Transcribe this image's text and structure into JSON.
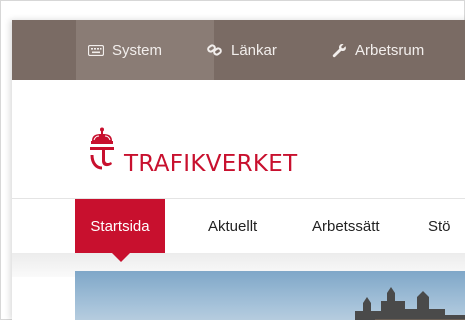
{
  "utility_bar": {
    "items": [
      {
        "label": "System",
        "icon": "keyboard-icon",
        "active": true
      },
      {
        "label": "Länkar",
        "icon": "link-icon",
        "active": false
      },
      {
        "label": "Arbetsrum",
        "icon": "wrench-icon",
        "active": false
      }
    ],
    "bg_color": "#7a6b64"
  },
  "header": {
    "logo_text": "TRAFIKVERKET",
    "brand_color": "#c8102e"
  },
  "nav": {
    "items": [
      {
        "label": "Startsida",
        "active": true
      },
      {
        "label": "Aktuellt",
        "active": false
      },
      {
        "label": "Arbetssätt",
        "active": false
      },
      {
        "label": "Stö",
        "active": false
      }
    ]
  }
}
